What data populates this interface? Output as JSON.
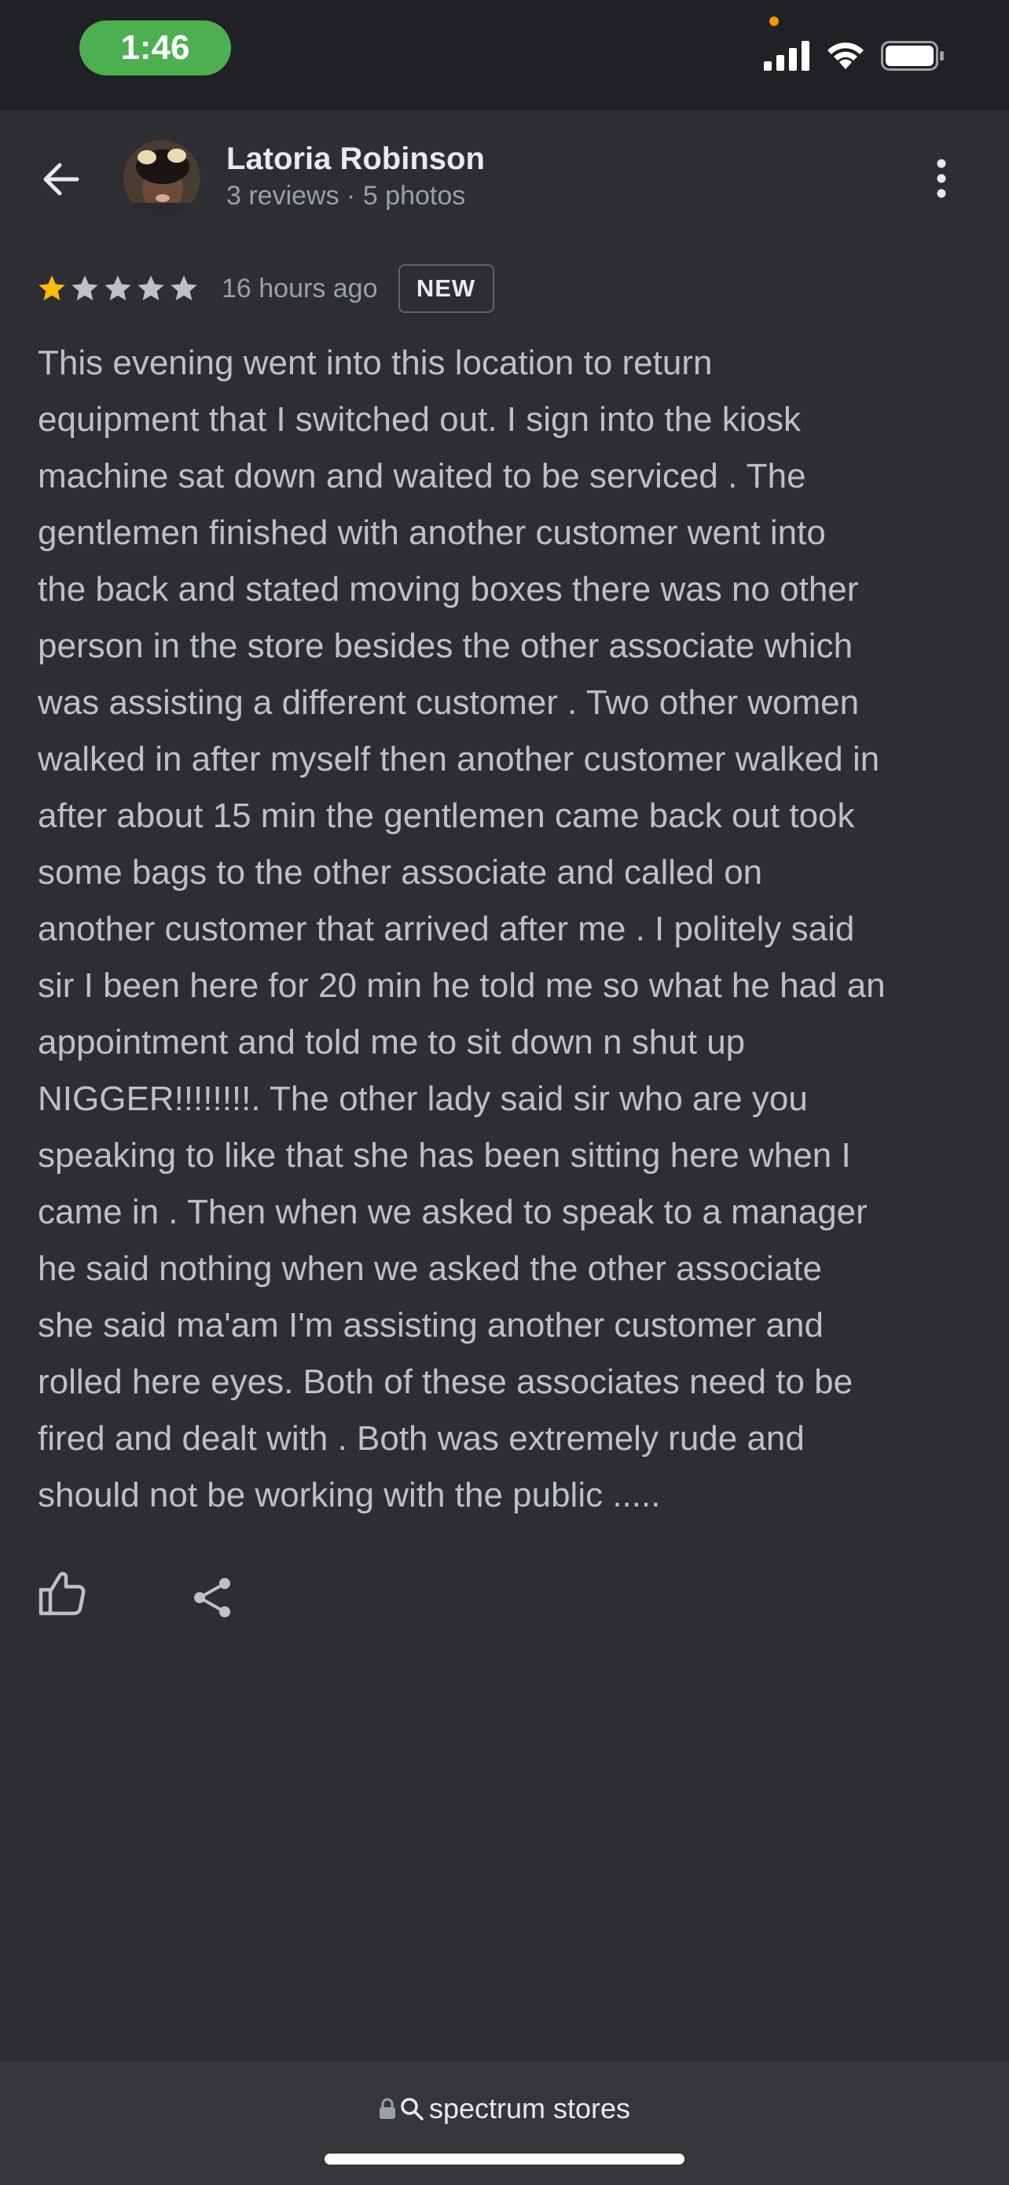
{
  "status_bar": {
    "time": "1:46"
  },
  "reviewer": {
    "name": "Latoria Robinson",
    "meta": "3 reviews · 5 photos"
  },
  "review": {
    "rating": 1,
    "max_rating": 5,
    "time": "16 hours ago",
    "badge": "NEW",
    "text": "This evening went into this location to return\nequipment that I switched out. I sign into the kiosk\nmachine sat down and waited to be serviced . The\ngentlemen finished with another customer went into\nthe back and stated moving boxes there was no other\nperson in the store besides the other associate which\nwas assisting a different customer . Two other women\nwalked in after myself then another customer walked in\nafter about 15 min the gentlemen came back out took\nsome bags to the other associate and called on\nanother customer that arrived after me . I politely said\nsir I been here for 20 min he told me so what he had an\nappointment and told me to sit down n shut up\nNIGGER!!!!!!!!. The other lady said sir who are you\nspeaking to like that she has been sitting here when I\ncame in . Then when we asked to speak to a manager\nhe said nothing when we asked the other associate\nshe said ma'am I'm assisting another customer and\nrolled here eyes. Both of these associates need to be\nfired and dealt with . Both was extremely rude and\nshould not be working with the public ....."
  },
  "bottom_bar": {
    "url": "spectrum stores"
  },
  "icons": {
    "back": "arrow-left-icon",
    "menu": "more-vert-icon",
    "like": "thumbs-up-icon",
    "share": "share-icon",
    "lock": "lock-icon",
    "search": "search-icon"
  },
  "colors": {
    "star_filled": "#fbbc04",
    "star_empty": "#bdc1c6",
    "time_pill": "#4caf50",
    "background": "#2d2e31"
  }
}
